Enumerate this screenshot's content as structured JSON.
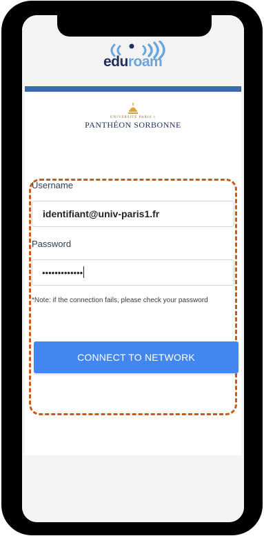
{
  "header": {
    "logo_edu": "edu",
    "logo_roam": "roam"
  },
  "institution": {
    "small_text": "UNIVERSITÉ PARIS 1",
    "name": "PANTHÉON SORBONNE"
  },
  "form": {
    "username_label": "Username",
    "username_value": "identifiant@univ-paris1.fr",
    "password_label": "Password",
    "password_value": "•••••••••••••",
    "note": "*Note: if the connection fails, please check your password",
    "connect_label": "CONNECT TO NETWORK"
  },
  "colors": {
    "accent_button": "#4187ef",
    "header_bar": "#3a6ba6",
    "highlight_frame": "#c85a1a"
  }
}
